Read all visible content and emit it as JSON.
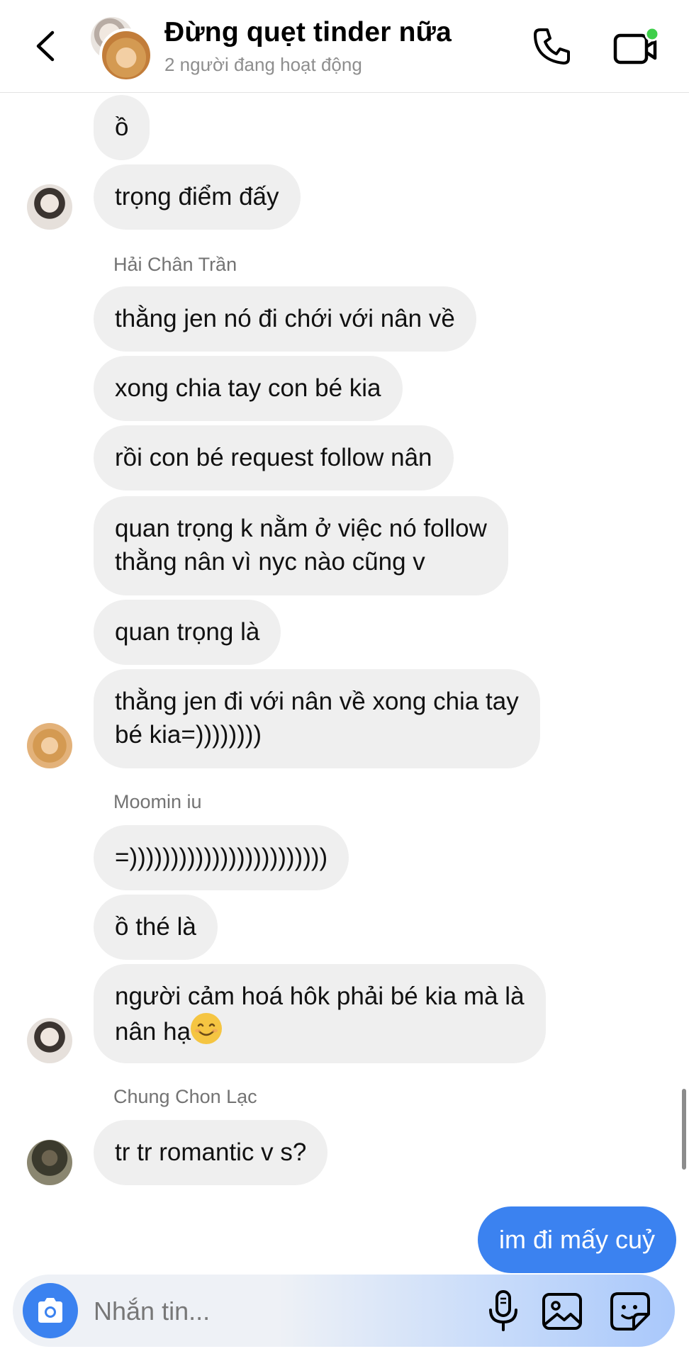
{
  "header": {
    "title": "Đừng quẹt tinder nữa",
    "subtitle": "2 người đang hoạt động"
  },
  "messages": [
    {
      "text": "ồ"
    },
    {
      "text": "trọng điểm đấy"
    },
    {
      "sender": "Hải Chân Trần"
    },
    {
      "text": "thằng jen nó đi chới với nân về"
    },
    {
      "text": "xong chia tay con bé kia"
    },
    {
      "text": "rồi con bé request follow nân"
    },
    {
      "line1": "quan trọng k nằm ở việc nó follow",
      "line2": "thằng nân vì nyc nào cũng v"
    },
    {
      "text": "quan trọng là"
    },
    {
      "line1": "thằng jen đi với nân về xong chia tay",
      "line2": "bé kia=))))))))"
    },
    {
      "sender": "Moomin iu"
    },
    {
      "text": "=))))))))))))))))))))))))"
    },
    {
      "text": "ồ thé là"
    },
    {
      "line1": "người cảm hoá hôk phải bé kia mà là",
      "line2": "nân hạ"
    },
    {
      "sender": "Chung Chon Lạc"
    },
    {
      "text": "tr tr romantic v s?"
    },
    {
      "text": "im đi mấy cuỷ",
      "mine": true
    }
  ],
  "composer": {
    "placeholder": "Nhắn tin..."
  },
  "icons": {
    "back": "chevron-left-icon",
    "call": "phone-icon",
    "video": "video-call-icon",
    "camera": "camera-icon",
    "mic": "microphone-icon",
    "gallery": "image-icon",
    "sticker": "sticker-icon",
    "emoji": "smiling-face-emoji"
  },
  "colors": {
    "accent": "#3b82f0",
    "bubble_received": "#efefef",
    "active_dot": "#3ecf4a"
  }
}
